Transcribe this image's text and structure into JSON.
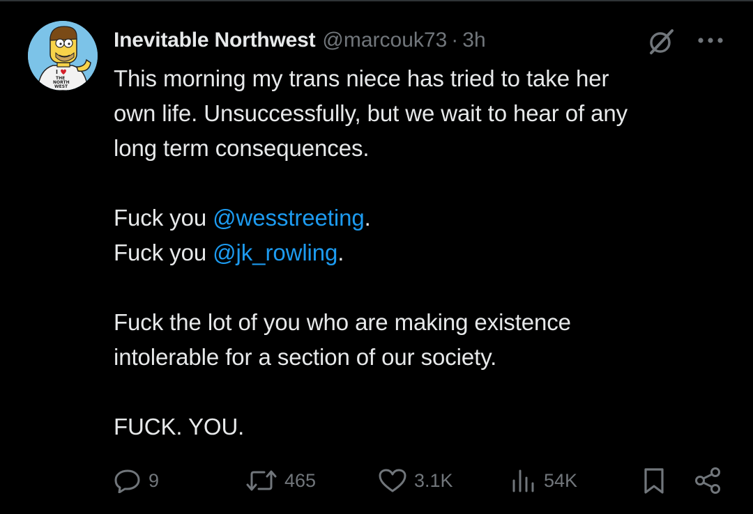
{
  "tweet": {
    "author": {
      "display_name": "Inevitable Northwest",
      "handle": "@marcouk73",
      "separator": "·",
      "time": "3h",
      "avatar_shirt_text": "I ♥ THE NORTH WEST"
    },
    "body": {
      "line1": "This morning my trans niece has tried to take her",
      "line2": "own life. Unsuccessfully, but we wait to hear of any",
      "line3": "long term consequences.",
      "line4_prefix": "Fuck you ",
      "line4_mention": "@wesstreeting",
      "line4_suffix": ".",
      "line5_prefix": "Fuck you ",
      "line5_mention": "@jk_rowling",
      "line5_suffix": ".",
      "line6": "Fuck the lot of you who are making existence",
      "line7": "intolerable for a section of our society.",
      "line8": "FUCK. YOU."
    },
    "actions": {
      "replies": "9",
      "reposts": "465",
      "likes": "3.1K",
      "views": "54K"
    },
    "icons": {
      "more": "more-horizontal-icon",
      "grok": "grok-icon",
      "reply": "reply-icon",
      "repost": "repost-icon",
      "like": "heart-icon",
      "views": "views-icon",
      "bookmark": "bookmark-icon",
      "share": "share-icon"
    },
    "colors": {
      "background": "#000000",
      "text": "#e7e9ea",
      "secondary": "#71767b",
      "mention": "#1d9bf0"
    }
  }
}
